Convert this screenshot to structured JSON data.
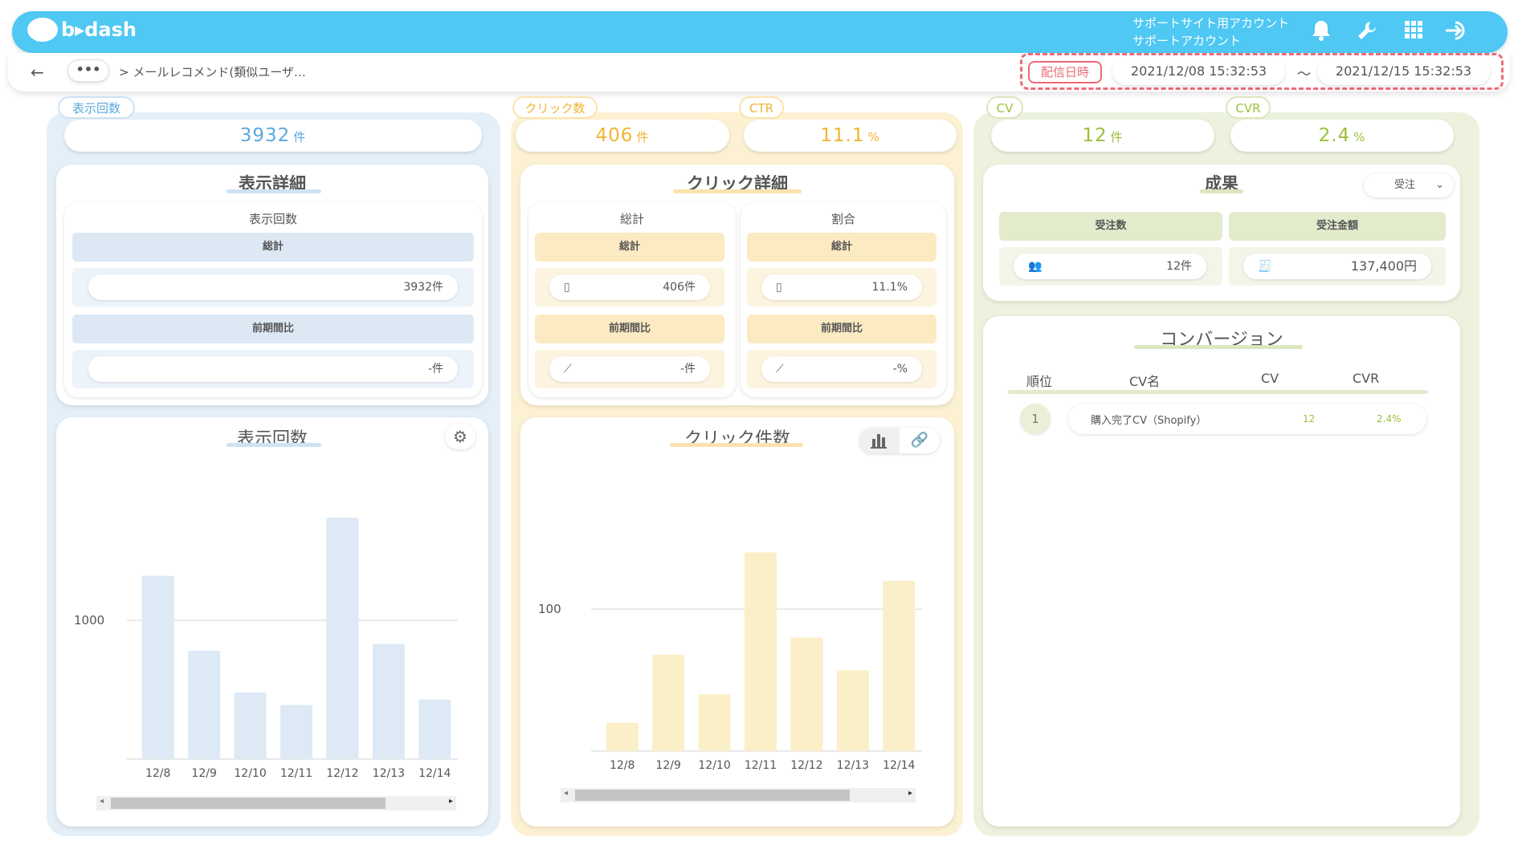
{
  "header": {
    "logo": "b▸dash",
    "account_line1": "サポートサイト用アカウント",
    "account_line2": "サポートアカウント",
    "icons": [
      "bell-icon",
      "wrench-icon",
      "grid-icon",
      "logout-icon"
    ]
  },
  "nav": {
    "back": "←",
    "more": "•••",
    "breadcrumb": "> メールレコメンド(類似ユーザ…",
    "date_label": "配信日時",
    "date_from": "2021/12/08 15:32:53",
    "tilde": "～",
    "date_to": "2021/12/15 15:32:53"
  },
  "impressions": {
    "tag": "表示回数",
    "value": "3932",
    "unit": "件",
    "detail_title": "表示詳細",
    "sub_title": "表示回数",
    "total_label": "総計",
    "total_value": "3932件",
    "prev_label": "前期間比",
    "prev_value": "-件",
    "chart_title": "表示回数"
  },
  "clicks": {
    "tag": "クリック数",
    "value": "406",
    "unit": "件",
    "ctr_tag": "CTR",
    "ctr_value": "11.1",
    "ctr_unit": "%",
    "detail_title": "クリック詳細",
    "total_col": "総計",
    "ratio_col": "割合",
    "total_label": "総計",
    "total_value": "406件",
    "ratio_value": "11.1%",
    "prev_label": "前期間比",
    "prev_value": "-件",
    "prev_ratio": "-%",
    "chart_title": "クリック件数"
  },
  "conversion": {
    "cv_tag": "CV",
    "cv_value": "12",
    "cv_unit": "件",
    "cvr_tag": "CVR",
    "cvr_value": "2.4",
    "cvr_unit": "%",
    "result_title": "成果",
    "select_value": "受注",
    "orders_label": "受注数",
    "orders_value": "12件",
    "amount_label": "受注金額",
    "amount_value": "137,400円",
    "list_title": "コンバージョン",
    "headers": [
      "順位",
      "CV名",
      "CV",
      "CVR"
    ],
    "rows": [
      {
        "rank": "1",
        "name": "購入完了CV（Shopify）",
        "cv": "12",
        "cvr": "2.4%"
      }
    ]
  },
  "colors": {
    "blue": "#5aa9dd",
    "yellow": "#f2b431",
    "green": "#9cbf3a",
    "bar_blue": "#dde9f5",
    "bar_yellow": "#fbefc8",
    "header": "#4fc8f3",
    "date_highlight": "#ee6a77"
  },
  "chart_data": [
    {
      "type": "bar",
      "title": "表示回数",
      "categories": [
        "12/8",
        "12/9",
        "12/10",
        "12/11",
        "12/12",
        "12/13",
        "12/14"
      ],
      "values": [
        1320,
        780,
        480,
        390,
        1740,
        830,
        430
      ],
      "ytick": "1000",
      "ylim": [
        0,
        2000
      ]
    },
    {
      "type": "bar",
      "title": "クリック件数",
      "categories": [
        "12/8",
        "12/9",
        "12/10",
        "12/11",
        "12/12",
        "12/13",
        "12/14"
      ],
      "values": [
        20,
        68,
        40,
        140,
        80,
        57,
        120
      ],
      "ytick": "100",
      "ylim": [
        0,
        190
      ]
    }
  ]
}
